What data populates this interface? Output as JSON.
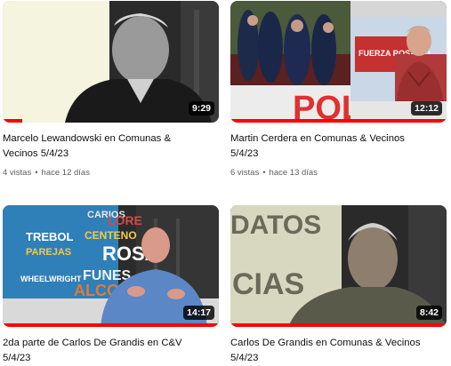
{
  "videos": [
    {
      "title": "Marcelo Lewandowski en Comunas &\nVecinos 5/4/23",
      "duration": "9:29",
      "views": "4 vistas",
      "age": "hace 12 días",
      "watched_fraction": 0.09
    },
    {
      "title": "Martin Cerdera en Comunas & Vecinos\n5/4/23",
      "duration": "12:12",
      "views": "6 vistas",
      "age": "hace 13 días",
      "watched_fraction": 1.0
    },
    {
      "title": "2da parte de Carlos De Grandis en C&V\n5/4/23",
      "duration": "14:17",
      "views": "",
      "age": "",
      "watched_fraction": 1.0
    },
    {
      "title": "Carlos De Grandis en Comunas & Vecinos\n5/4/23",
      "duration": "8:42",
      "views": "",
      "age": "",
      "watched_fraction": 1.0
    }
  ],
  "thumbnail_art": {
    "video2_sign": "FUERZA ROSARIO",
    "video2_bg_text": "POL",
    "video3_words": [
      "CARIOS",
      "LORE",
      "TREBOL",
      "CENTENO",
      "PAREJAS",
      "ROSA",
      "FUNES",
      "WHEELWRIGHT",
      "ALCO"
    ],
    "video4_words": [
      "DATOS",
      "CIAS"
    ]
  },
  "colors": {
    "progress": "#ff0000",
    "meta_text": "#606060"
  }
}
